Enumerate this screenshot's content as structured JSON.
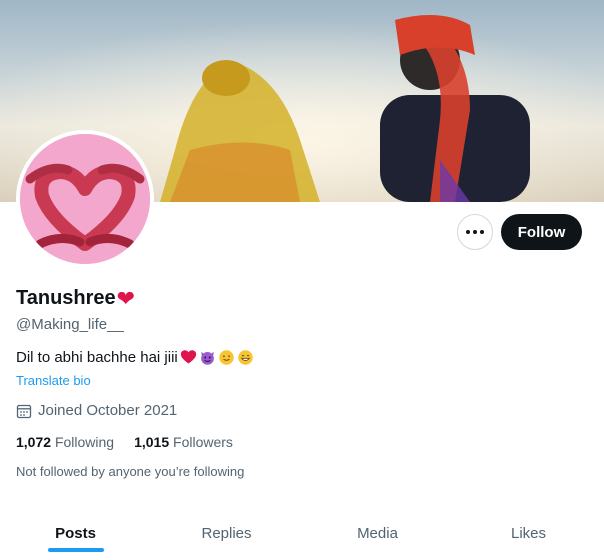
{
  "profile": {
    "display_name": "Tanushree",
    "name_emoji": "❤",
    "handle": "@Making_life__",
    "bio_text": "Dil to abhi bachhe hai jiii",
    "translate_label": "Translate bio",
    "joined": "Joined October 2021",
    "following_count": "1,072",
    "following_label": "Following",
    "followers_count": "1,015",
    "followers_label": "Followers",
    "not_followed": "Not followed by anyone you’re following"
  },
  "actions": {
    "follow_label": "Follow"
  },
  "tabs": [
    {
      "label": "Posts",
      "active": true
    },
    {
      "label": "Replies",
      "active": false
    },
    {
      "label": "Media",
      "active": false
    },
    {
      "label": "Likes",
      "active": false
    }
  ],
  "colors": {
    "accent": "#1d9bf0",
    "heart": "#e0144c",
    "follow_bg": "#0f1419"
  },
  "icons": [
    "more-horizontal-icon",
    "calendar-icon",
    "heart-emoji",
    "devil-emoji",
    "smile-emoji",
    "grin-emoji"
  ]
}
